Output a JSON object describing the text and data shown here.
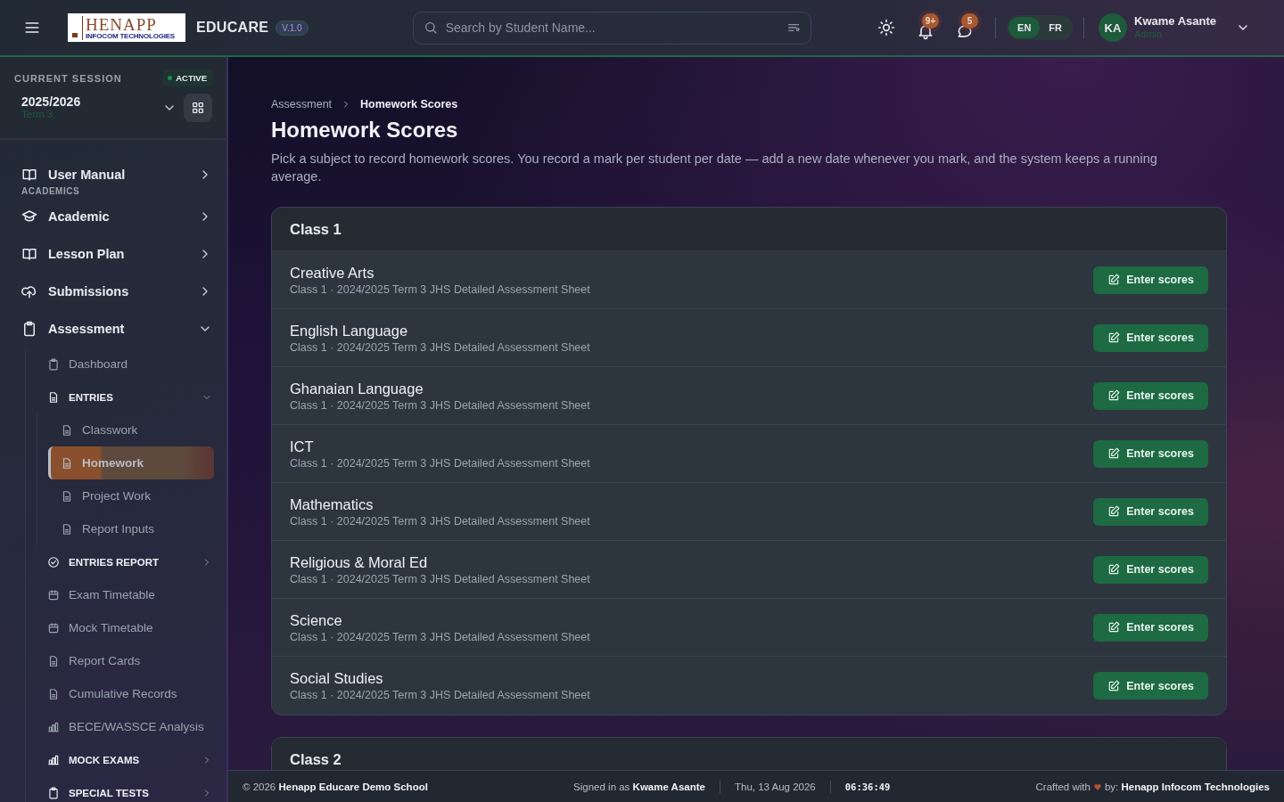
{
  "header": {
    "logo": {
      "name": "HENAPP",
      "tagline": "INFOCOM TECHNOLOGIES"
    },
    "app_name": "EDUCARE",
    "version": "V.1.0",
    "search": {
      "placeholder": "Search by Student Name..."
    },
    "notifications": {
      "badge": "9+"
    },
    "messages": {
      "badge": "5"
    },
    "languages": [
      {
        "label": "EN",
        "selected": true
      },
      {
        "label": "FR",
        "selected": false
      }
    ],
    "user": {
      "initials": "KA",
      "name": "Kwame Asante",
      "role": "Admin"
    }
  },
  "sidebar": {
    "session": {
      "label": "CURRENT SESSION",
      "status": "ACTIVE",
      "year": "2025/2026",
      "term": "Term 3"
    },
    "items": [
      {
        "kind": "link",
        "label": "User Manual",
        "expanded": false
      },
      {
        "kind": "heading",
        "label": "ACADEMICS"
      },
      {
        "kind": "link",
        "label": "Academic",
        "expanded": false
      },
      {
        "kind": "link",
        "label": "Lesson Plan",
        "expanded": false
      },
      {
        "kind": "link",
        "label": "Submissions",
        "expanded": false
      },
      {
        "kind": "link",
        "label": "Assessment",
        "expanded": true,
        "children": [
          {
            "kind": "leaf",
            "label": "Dashboard",
            "selected": false
          },
          {
            "kind": "group",
            "label": "ENTRIES",
            "expanded": true,
            "children": [
              {
                "kind": "leaf",
                "label": "Classwork",
                "selected": false
              },
              {
                "kind": "leaf",
                "label": "Homework",
                "selected": true
              },
              {
                "kind": "leaf",
                "label": "Project Work",
                "selected": false
              },
              {
                "kind": "leaf",
                "label": "Report Inputs",
                "selected": false
              }
            ]
          },
          {
            "kind": "group",
            "label": "ENTRIES REPORT",
            "expanded": false
          },
          {
            "kind": "leaf",
            "label": "Exam Timetable",
            "selected": false
          },
          {
            "kind": "leaf",
            "label": "Mock Timetable",
            "selected": false
          },
          {
            "kind": "leaf",
            "label": "Report Cards",
            "selected": false
          },
          {
            "kind": "leaf",
            "label": "Cumulative Records",
            "selected": false
          },
          {
            "kind": "leaf",
            "label": "BECE/WASSCE Analysis",
            "selected": false
          },
          {
            "kind": "group",
            "label": "MOCK EXAMS",
            "expanded": false
          },
          {
            "kind": "group",
            "label": "SPECIAL TESTS",
            "expanded": false
          }
        ]
      }
    ]
  },
  "breadcrumb": [
    "Assessment",
    "Homework Scores"
  ],
  "title": "Homework Scores",
  "description": "Pick a subject to record homework scores. You record a mark per student per date — add a new date whenever you mark, and the system keeps a running average.",
  "classes": [
    {
      "name": "Class 1",
      "subjects": [
        {
          "name": "Creative Arts",
          "detail": "Class 1 · 2024/2025 Term 3 JHS Detailed Assessment Sheet",
          "action": "Enter scores"
        },
        {
          "name": "English Language",
          "detail": "Class 1 · 2024/2025 Term 3 JHS Detailed Assessment Sheet",
          "action": "Enter scores"
        },
        {
          "name": "Ghanaian Language",
          "detail": "Class 1 · 2024/2025 Term 3 JHS Detailed Assessment Sheet",
          "action": "Enter scores"
        },
        {
          "name": "ICT",
          "detail": "Class 1 · 2024/2025 Term 3 JHS Detailed Assessment Sheet",
          "action": "Enter scores"
        },
        {
          "name": "Mathematics",
          "detail": "Class 1 · 2024/2025 Term 3 JHS Detailed Assessment Sheet",
          "action": "Enter scores"
        },
        {
          "name": "Religious & Moral Ed",
          "detail": "Class 1 · 2024/2025 Term 3 JHS Detailed Assessment Sheet",
          "action": "Enter scores"
        },
        {
          "name": "Science",
          "detail": "Class 1 · 2024/2025 Term 3 JHS Detailed Assessment Sheet",
          "action": "Enter scores"
        },
        {
          "name": "Social Studies",
          "detail": "Class 1 · 2024/2025 Term 3 JHS Detailed Assessment Sheet",
          "action": "Enter scores"
        }
      ]
    },
    {
      "name": "Class 2"
    }
  ],
  "footer": {
    "copyright": "© 2026 **Henapp Educare Demo School**",
    "signed_in": "Signed in as **Kwame Asante**",
    "date": "Thu, 13 Aug 2026",
    "time": "06:36:49",
    "crafted": "Crafted with",
    "credit": "by: **Henapp Infocom Technologies**"
  }
}
